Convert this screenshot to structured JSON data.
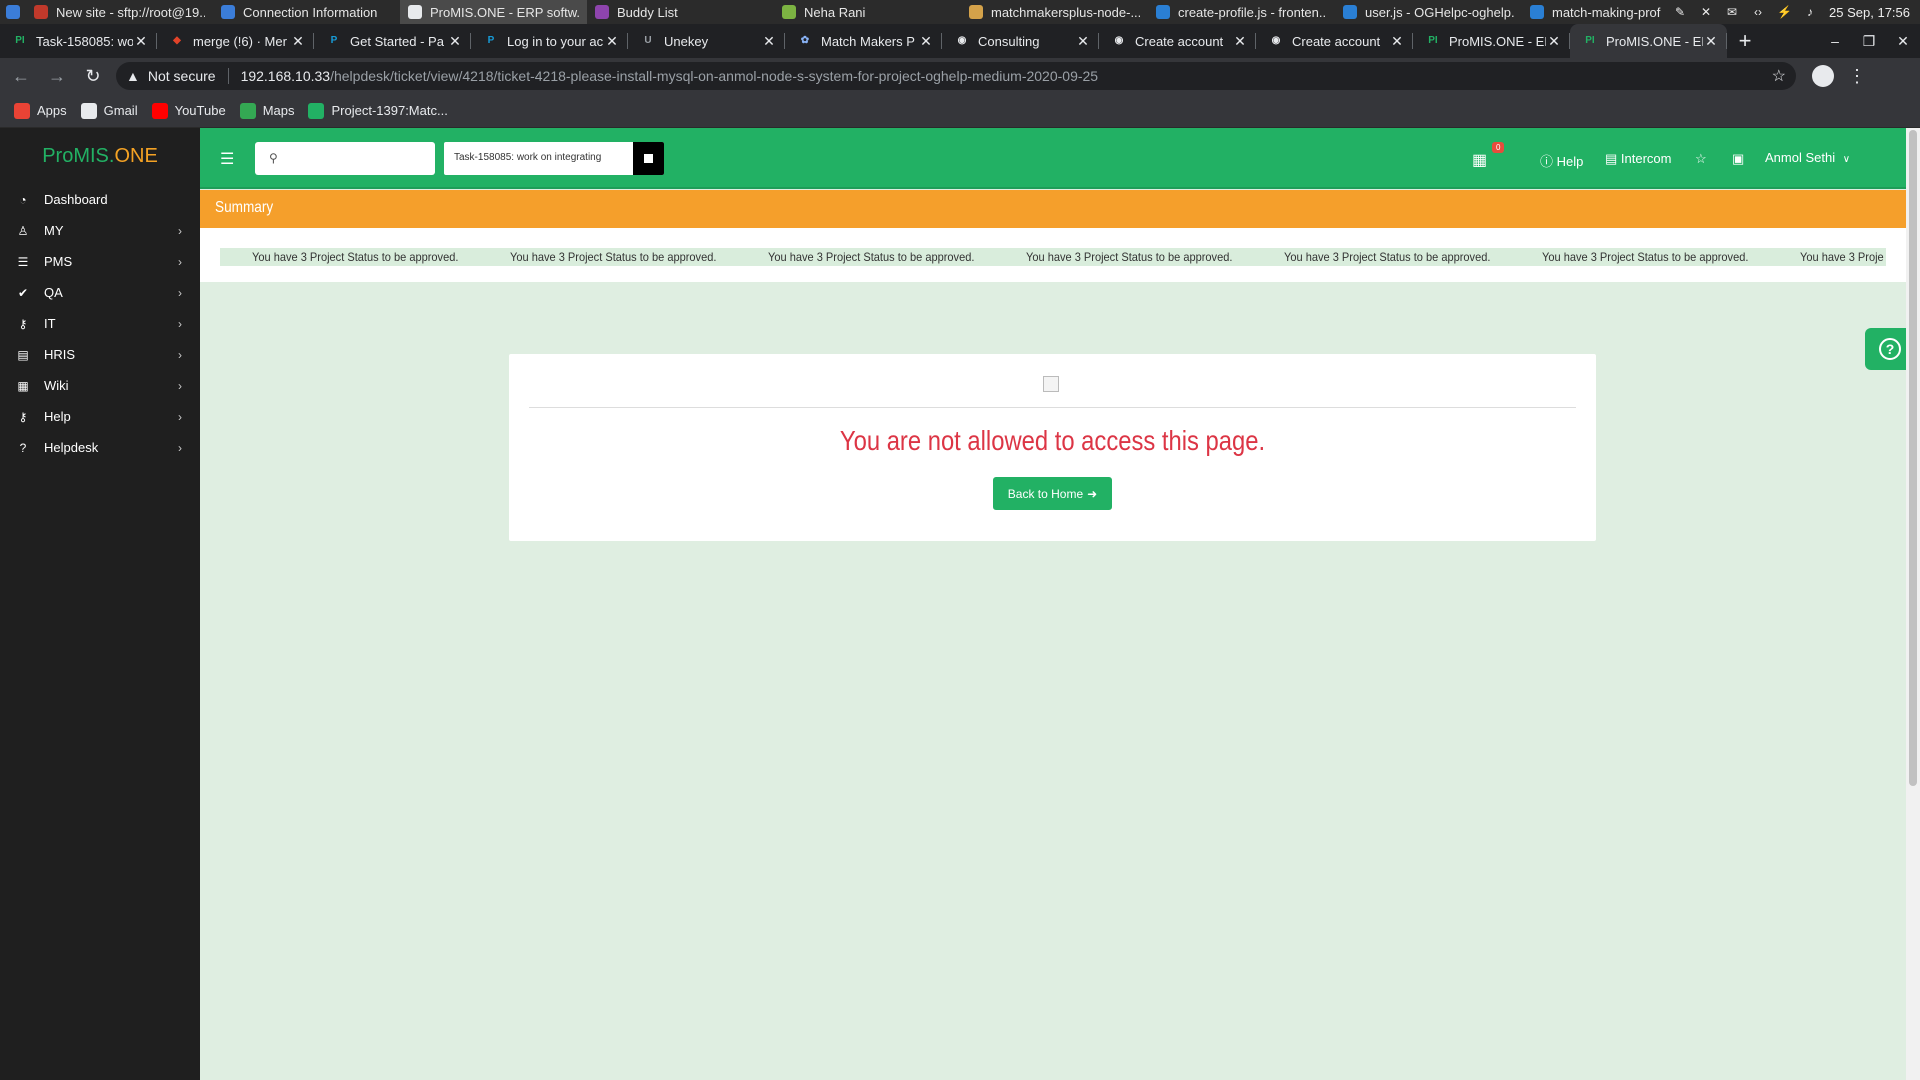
{
  "os_bar": {
    "items": [
      {
        "label": "New site - sftp://root@19...",
        "color": "#c0392b"
      },
      {
        "label": "Connection Information",
        "color": "#3b7dd8"
      },
      {
        "label": "ProMIS.ONE - ERP softw...",
        "color": "#e8eaed"
      },
      {
        "label": "Buddy List",
        "color": "#8e44ad"
      },
      {
        "label": "Neha Rani",
        "color": "#7cb342"
      },
      {
        "label": "matchmakersplus-node-...",
        "color": "#d4a24a"
      },
      {
        "label": "create-profile.js - fronten...",
        "color": "#2a7fd4"
      },
      {
        "label": "user.js - OGHelpc-oghelp...",
        "color": "#2a7fd4"
      },
      {
        "label": "match-making-profile.jsx...",
        "color": "#2a7fd4"
      }
    ],
    "clock": "25 Sep, 17:56"
  },
  "tabs": [
    {
      "label": "Task-158085: wo",
      "fav": "PI",
      "fav_color": "#22b164"
    },
    {
      "label": "merge (!6) · Mer",
      "fav": "◆",
      "fav_color": "#e24329"
    },
    {
      "label": "Get Started - Pa",
      "fav": "P",
      "fav_color": "#179bd7"
    },
    {
      "label": "Log in to your ac",
      "fav": "P",
      "fav_color": "#179bd7"
    },
    {
      "label": "Unekey",
      "fav": "U",
      "fav_color": "#9aa0a6"
    },
    {
      "label": "Match Makers P",
      "fav": "✿",
      "fav_color": "#8ab4f8"
    },
    {
      "label": "Consulting",
      "fav": "◉",
      "fav_color": "#e8eaed"
    },
    {
      "label": "Create account",
      "fav": "◉",
      "fav_color": "#e8eaed"
    },
    {
      "label": "Create account",
      "fav": "◉",
      "fav_color": "#e8eaed"
    },
    {
      "label": "ProMIS.ONE - ER",
      "fav": "PI",
      "fav_color": "#22b164"
    },
    {
      "label": "ProMIS.ONE - ER",
      "fav": "PI",
      "fav_color": "#22b164"
    }
  ],
  "active_tab_index": 10,
  "address": {
    "security": "Not secure",
    "host": "192.168.10.33",
    "path": "/helpdesk/ticket/view/4218/ticket-4218-please-install-mysql-on-anmol-node-s-system-for-project-oghelp-medium-2020-09-25"
  },
  "bookmarks": [
    {
      "label": "Apps",
      "color": "#ea4335",
      "icon": "apps-grid-icon"
    },
    {
      "label": "Gmail",
      "color": "#e8eaed",
      "icon": "google-icon"
    },
    {
      "label": "YouTube",
      "color": "#ff0000",
      "icon": "youtube-icon"
    },
    {
      "label": "Maps",
      "color": "#34a853",
      "icon": "maps-icon"
    },
    {
      "label": "Project-1397:Matc...",
      "color": "#22b164",
      "icon": "promis-icon"
    }
  ],
  "brand": {
    "part1": "ProMIS.",
    "part2": "ONE"
  },
  "sidebar": {
    "items": [
      {
        "label": "Dashboard",
        "icon": "dashboard-icon",
        "glyph": "◔",
        "has_children": false
      },
      {
        "label": "MY",
        "icon": "user-icon",
        "glyph": "♙",
        "has_children": true
      },
      {
        "label": "PMS",
        "icon": "list-icon",
        "glyph": "☰",
        "has_children": true
      },
      {
        "label": "QA",
        "icon": "check-icon",
        "glyph": "✔",
        "has_children": true
      },
      {
        "label": "IT",
        "icon": "key-icon",
        "glyph": "⚷",
        "has_children": true
      },
      {
        "label": "HRIS",
        "icon": "clipboard-icon",
        "glyph": "▤",
        "has_children": true
      },
      {
        "label": "Wiki",
        "icon": "table-icon",
        "glyph": "▦",
        "has_children": true
      },
      {
        "label": "Help",
        "icon": "key-icon",
        "glyph": "⚷",
        "has_children": true
      },
      {
        "label": "Helpdesk",
        "icon": "question-circle-icon",
        "glyph": "?",
        "has_children": true
      }
    ]
  },
  "topnav": {
    "search_placeholder": "",
    "task_text": "Task-158085: work on integrating",
    "apps_badge": "0",
    "help_label": "Help",
    "intercom_label": "Intercom",
    "user_name": "Anmol Sethi"
  },
  "summary": {
    "title": "Summary"
  },
  "marquee": {
    "messages": [
      "You have 3 Project Status to be approved.",
      "You have 3 Project Status to be approved.",
      "You have 3 Project Status to be approved.",
      "You have 3 Project Status to be approved.",
      "You have 3 Project Status to be approved.",
      "You have 3 Project Status to be approved.",
      "You have 3 Proje"
    ]
  },
  "error": {
    "title": "You are not allowed to access this page.",
    "button_label": "Back to Home"
  },
  "colors": {
    "brand_green": "#22b164",
    "summary_orange": "#f59f2b",
    "error_red": "#dc3545"
  }
}
